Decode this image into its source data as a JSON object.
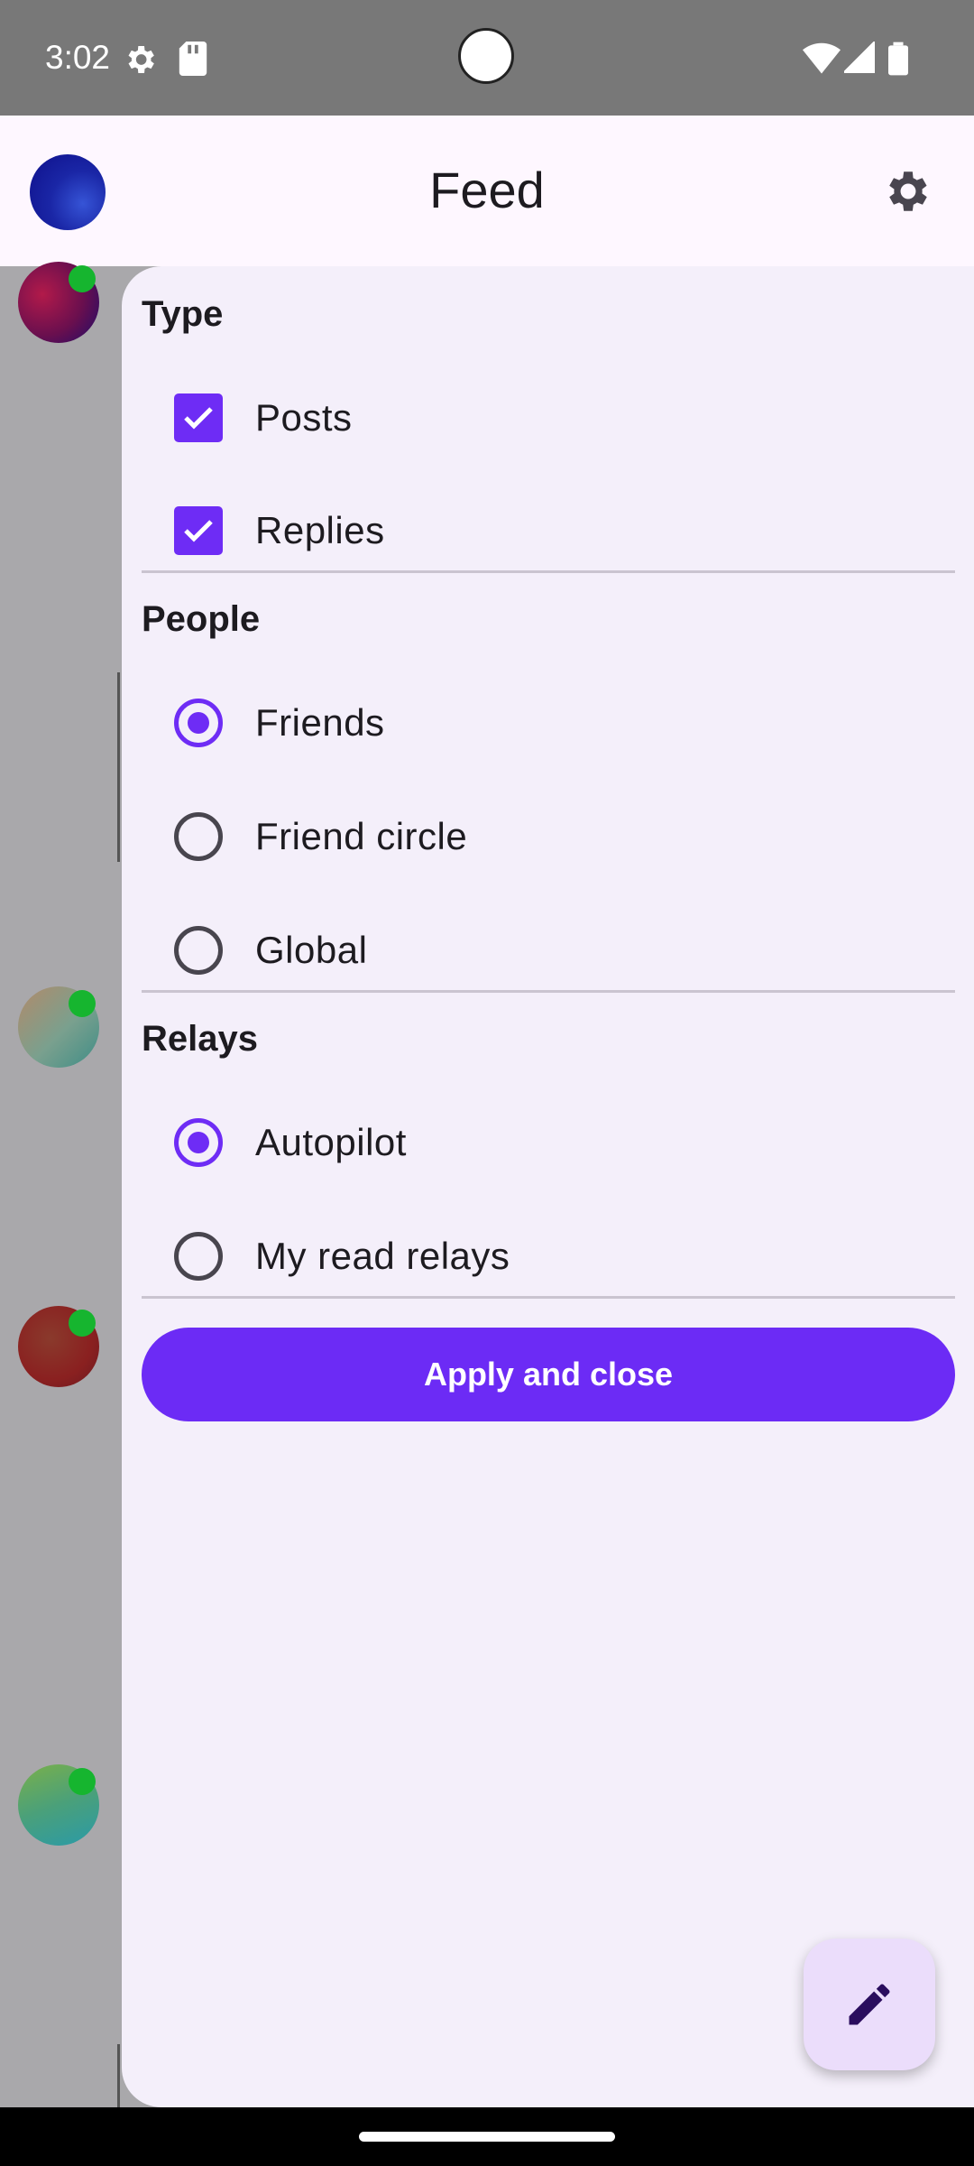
{
  "status_bar": {
    "time": "3:02"
  },
  "app_bar": {
    "title": "Feed"
  },
  "drawer": {
    "sections": {
      "type": {
        "title": "Type",
        "options": [
          {
            "label": "Posts",
            "checked": true
          },
          {
            "label": "Replies",
            "checked": true
          }
        ]
      },
      "people": {
        "title": "People",
        "options": [
          {
            "label": "Friends",
            "selected": true
          },
          {
            "label": "Friend circle",
            "selected": false
          },
          {
            "label": "Global",
            "selected": false
          }
        ]
      },
      "relays": {
        "title": "Relays",
        "options": [
          {
            "label": "Autopilot",
            "selected": true
          },
          {
            "label": "My read relays",
            "selected": false
          }
        ]
      }
    },
    "apply_button": "Apply and close"
  },
  "fab": {
    "icon": "edit-pencil-icon"
  },
  "colors": {
    "accent": "#6c2bf5",
    "drawer_bg": "#f4effa",
    "appbar_bg": "#fef7ff"
  }
}
